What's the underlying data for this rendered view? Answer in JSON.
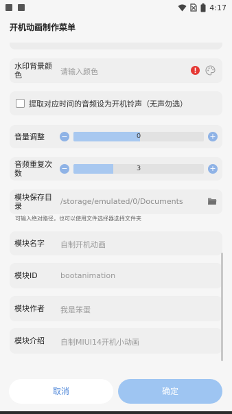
{
  "status_bar": {
    "time": "4:17",
    "icons": [
      "wifi-icon",
      "no-sim-icon",
      "battery-icon"
    ]
  },
  "dialog": {
    "title": "开机动画制作菜单"
  },
  "watermark_color": {
    "label": "水印背景颜色",
    "placeholder": "请输入颜色",
    "error_icon_color": "#e53935",
    "icons": [
      "error-icon",
      "palette-icon"
    ]
  },
  "ringtone_option": {
    "label": "提取对应时间的音频设为开机铃声（无声勿选）",
    "checked": false
  },
  "volume": {
    "label": "音量调整",
    "value": "0",
    "minus": "−",
    "plus": "+"
  },
  "audio_repeat": {
    "label": "音频重复次数",
    "value": "3",
    "minus": "−",
    "plus": "+"
  },
  "save_dir": {
    "label": "模块保存目录",
    "value": "/storage/emulated/0/Documents",
    "hint": "可输入绝对路径，也可以使用文件选择器选择文件夹",
    "icon": "folder-icon"
  },
  "module_name": {
    "label": "模块名字",
    "placeholder": "自制开机动画"
  },
  "module_id": {
    "label": "模块ID",
    "placeholder": "bootanimation"
  },
  "module_author": {
    "label": "模块作者",
    "placeholder": "我是笨蛋"
  },
  "module_desc": {
    "label": "模块介绍",
    "placeholder": "自制MIUI14开机小动画"
  },
  "buttons": {
    "cancel": "取消",
    "ok": "确定"
  },
  "colors": {
    "accent": "#4d86d9",
    "primary_button": "#9ec5f2",
    "slider_fill": "#a8c8f0"
  }
}
